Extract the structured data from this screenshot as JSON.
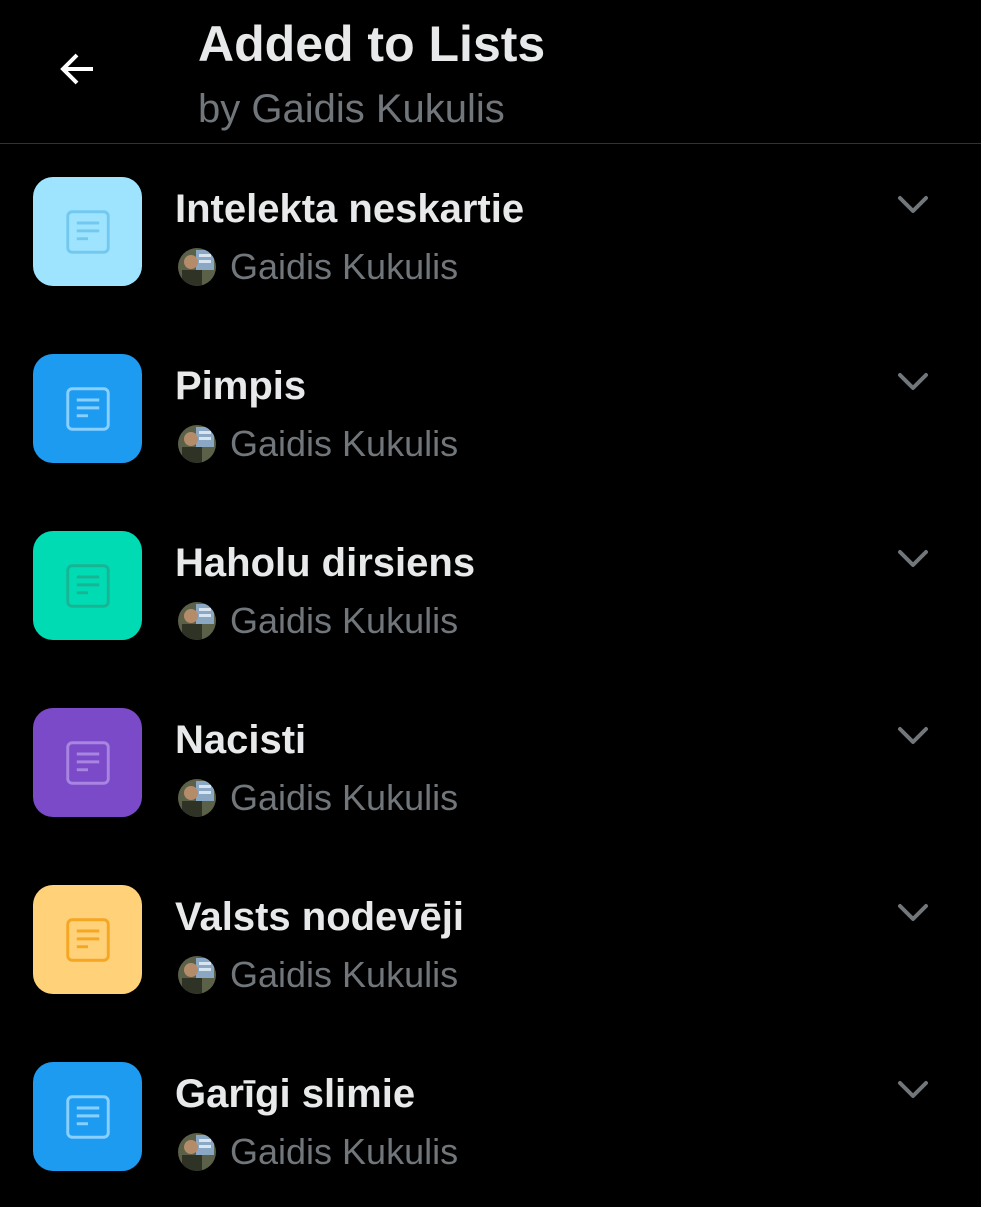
{
  "header": {
    "title": "Added to Lists",
    "subtitle": "by Gaidis Kukulis",
    "back_icon": "arrow-left-icon"
  },
  "lists": [
    {
      "name": "Intelekta neskartie",
      "owner": "Gaidis Kukulis",
      "tile_color": "#9fe4ff",
      "icon_color": "#73c8f0"
    },
    {
      "name": "Pimpis",
      "owner": "Gaidis Kukulis",
      "tile_color": "#1d9bf0",
      "icon_color": "#8ad0ff"
    },
    {
      "name": "Haholu dirsiens",
      "owner": "Gaidis Kukulis",
      "tile_color": "#00dbb4",
      "icon_color": "#18b594"
    },
    {
      "name": "Nacisti",
      "owner": "Gaidis Kukulis",
      "tile_color": "#7a4ac8",
      "icon_color": "#a785e0"
    },
    {
      "name": "Valsts nodevēji",
      "owner": "Gaidis Kukulis",
      "tile_color": "#ffd27a",
      "icon_color": "#f5a623"
    },
    {
      "name": "Garīgi slimie",
      "owner": "Gaidis Kukulis",
      "tile_color": "#1d9bf0",
      "icon_color": "#8ad0ff"
    }
  ],
  "icons": {
    "list_tile": "list-document-icon",
    "expand": "chevron-down-icon",
    "owner": "avatar"
  },
  "colors": {
    "background": "#000000",
    "primary_text": "#e7e9ea",
    "secondary_text": "#71767b",
    "divider": "#2f3336"
  }
}
